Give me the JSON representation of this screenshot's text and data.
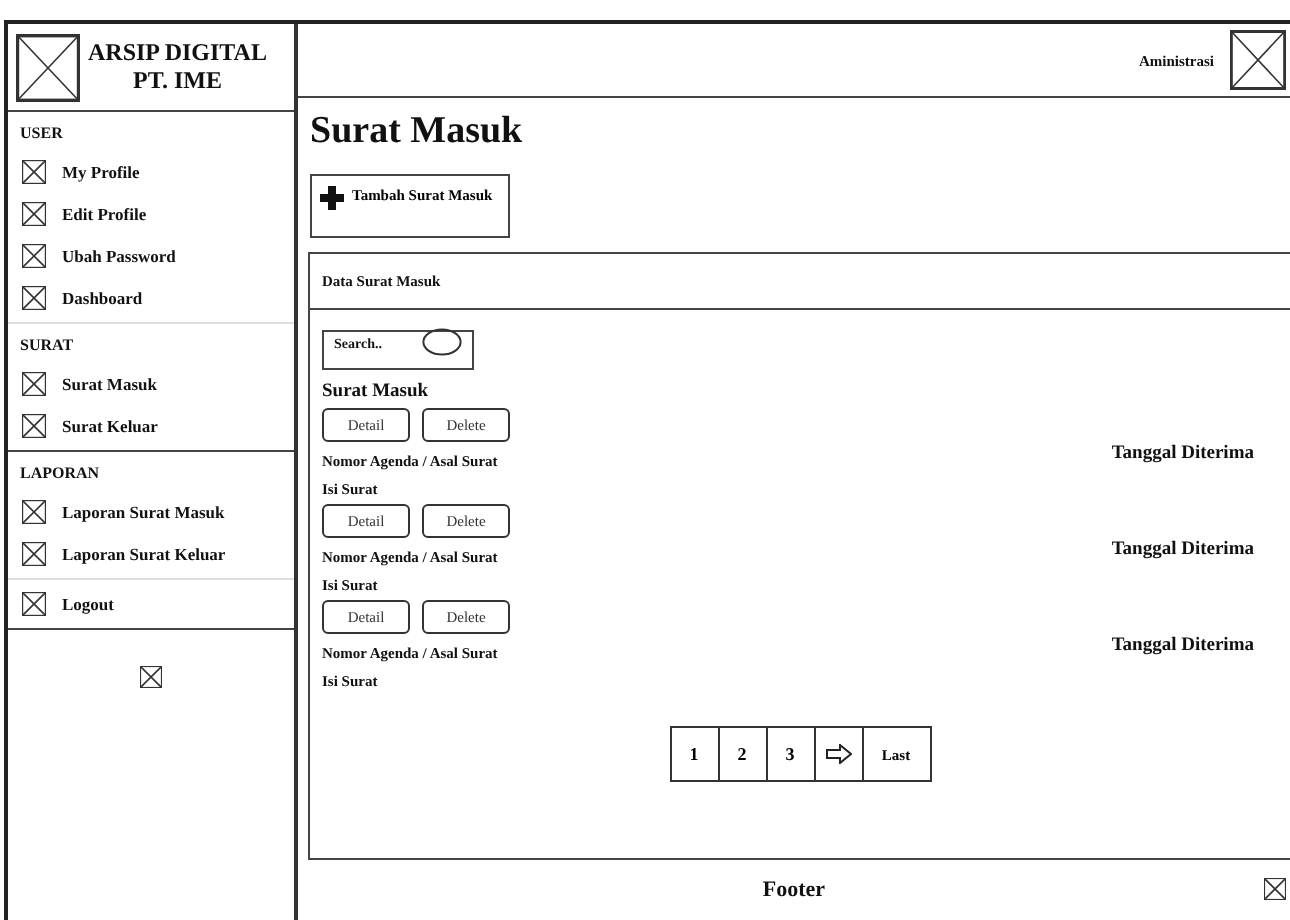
{
  "sidebar": {
    "brand": [
      "ARSIP DIGITAL",
      "PT. IME"
    ],
    "sections": [
      {
        "heading": "USER",
        "items": [
          "My Profile",
          "Edit Profile",
          "Ubah Password",
          "Dashboard"
        ]
      },
      {
        "heading": "SURAT",
        "items": [
          "Surat Masuk",
          "Surat Keluar"
        ]
      },
      {
        "heading": "LAPORAN",
        "items": [
          "Laporan Surat Masuk",
          "Laporan Surat Keluar"
        ]
      },
      {
        "items": [
          "Logout"
        ]
      }
    ]
  },
  "header": {
    "user": "Aministrasi"
  },
  "page_title": "Surat Masuk",
  "add_button": "Tambah Surat Masuk",
  "panel": {
    "title": "Data Surat Masuk",
    "search": {
      "placeholder": "Search.."
    },
    "list_title": "Surat Masuk",
    "entries": [
      {
        "buttons": [
          "Detail",
          "Delete"
        ],
        "agenda": "Nomor Agenda / Asal Surat",
        "content": "Isi Surat",
        "date": "Tanggal Diterima"
      },
      {
        "buttons": [
          "Detail",
          "Delete"
        ],
        "agenda": "Nomor Agenda / Asal Surat",
        "content": "Isi Surat",
        "date": "Tanggal Diterima"
      },
      {
        "buttons": [
          "Detail",
          "Delete"
        ],
        "agenda": "Nomor Agenda / Asal Surat",
        "content": "Isi Surat",
        "date": "Tanggal Diterima"
      }
    ],
    "pagination": [
      {
        "kind": "page",
        "label": "1"
      },
      {
        "kind": "page",
        "label": "2"
      },
      {
        "kind": "page",
        "label": "3"
      },
      {
        "kind": "next"
      },
      {
        "kind": "page",
        "label": "Last"
      }
    ]
  },
  "footer": "Footer"
}
